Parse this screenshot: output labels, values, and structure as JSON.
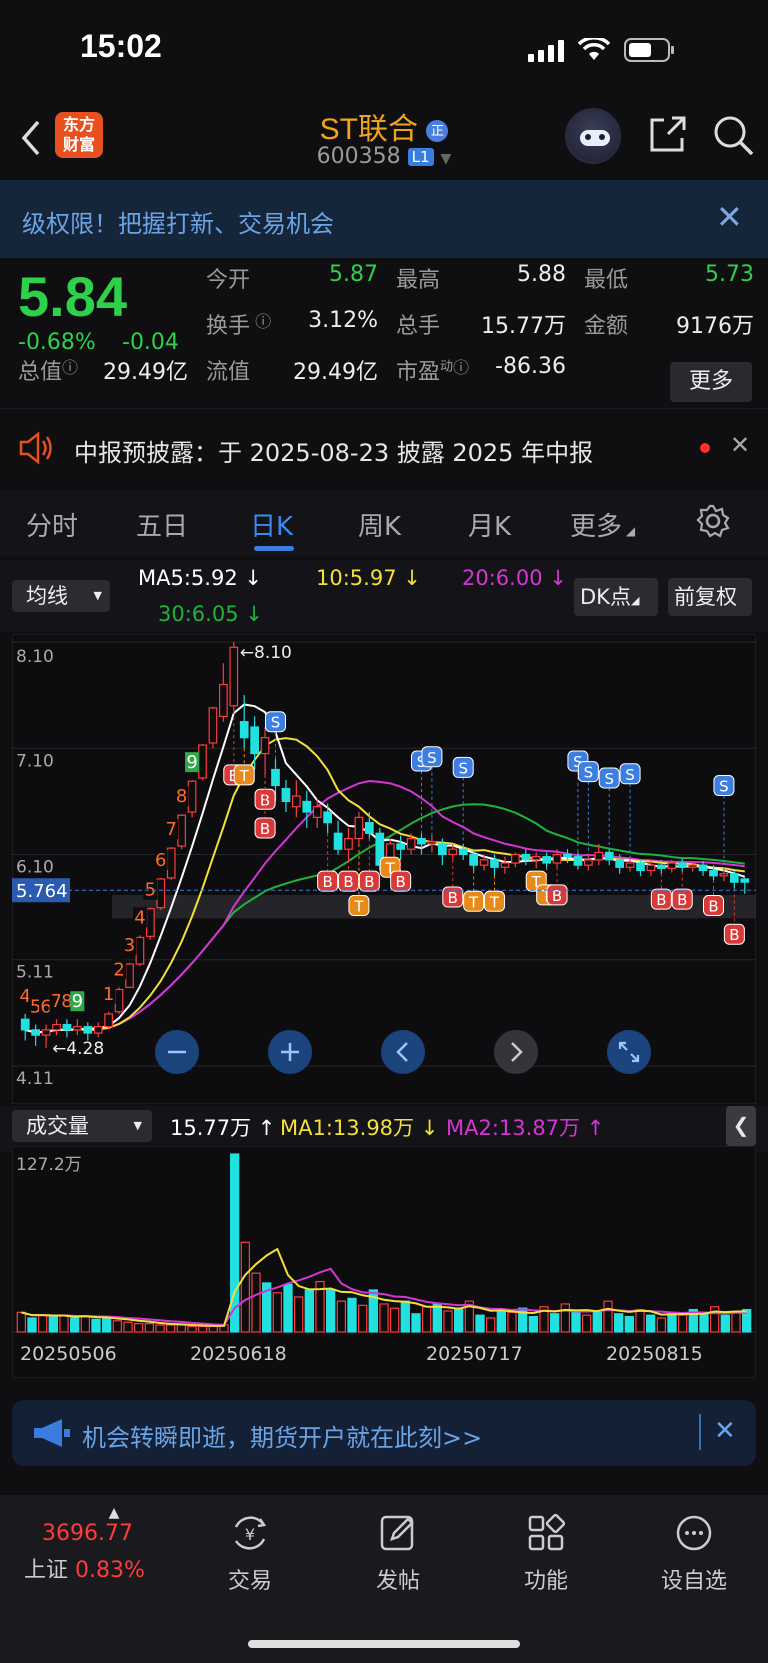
{
  "status_bar": {
    "time": "15:02"
  },
  "header": {
    "logo_text_1": "东方",
    "logo_text_2": "财富",
    "title": "ST联合",
    "title_badge": "正",
    "code": "600358",
    "level_badge": "L1"
  },
  "banner": {
    "text": "级权限！把握打新、交易机会"
  },
  "quote": {
    "price": "5.84",
    "change_pct": "-0.68%",
    "change": "-0.04",
    "fields": [
      {
        "label": "今开",
        "value": "5.87",
        "color": "green"
      },
      {
        "label": "最高",
        "value": "5.88",
        "color": "white"
      },
      {
        "label": "最低",
        "value": "5.73",
        "color": "green"
      },
      {
        "label": "换手",
        "value": "3.12%",
        "color": "white"
      },
      {
        "label": "总手",
        "value": "15.77万",
        "color": "white"
      },
      {
        "label": "金额",
        "value": "9176万",
        "color": "white"
      },
      {
        "label": "总值",
        "value": "29.49亿",
        "color": "white"
      },
      {
        "label": "流值",
        "value": "29.49亿",
        "color": "white"
      },
      {
        "label": "市盈",
        "label_sup": "动",
        "value": "-86.36",
        "color": "white"
      }
    ],
    "more_button": "更多"
  },
  "notice": {
    "text": "中报预披露：于 2025-08-23 披露 2025 年中报"
  },
  "tabs": [
    "分时",
    "五日",
    "日K",
    "周K",
    "月K",
    "更多"
  ],
  "active_tab": "日K",
  "ma_row": {
    "selector": "均线",
    "ma5": "MA5:5.92 ↓",
    "ma10": "10:5.97 ↓",
    "ma20": "20:6.00 ↓",
    "ma30": "30:6.05 ↓",
    "dk_button": "DK点",
    "fq_button": "前复权"
  },
  "colors": {
    "up": "#ff3b3b",
    "down": "#21e0e0",
    "green": "#2fd04a",
    "ma5": "#ffffff",
    "ma10": "#f2e03b",
    "ma20": "#d535d5",
    "ma30": "#1fb33a",
    "accent": "#3a7de0"
  },
  "chart_data": {
    "type": "candlestick",
    "y_labels": [
      "8.10",
      "7.10",
      "6.10",
      "5.11",
      "4.11"
    ],
    "price_line_label": "5.764",
    "high_label": "←8.10",
    "low_label": "←4.28",
    "candles": [
      {
        "o": 4.55,
        "c": 4.45,
        "h": 4.6,
        "l": 4.35
      },
      {
        "o": 4.45,
        "c": 4.4,
        "h": 4.5,
        "l": 4.3
      },
      {
        "o": 4.4,
        "c": 4.45,
        "h": 4.5,
        "l": 4.28
      },
      {
        "o": 4.45,
        "c": 4.5,
        "h": 4.55,
        "l": 4.4
      },
      {
        "o": 4.5,
        "c": 4.45,
        "h": 4.55,
        "l": 4.38
      },
      {
        "o": 4.45,
        "c": 4.48,
        "h": 4.55,
        "l": 4.4
      },
      {
        "o": 4.48,
        "c": 4.42,
        "h": 4.52,
        "l": 4.35
      },
      {
        "o": 4.42,
        "c": 4.48,
        "h": 4.52,
        "l": 4.38
      },
      {
        "o": 4.48,
        "c": 4.6,
        "h": 4.62,
        "l": 4.45
      },
      {
        "o": 4.62,
        "c": 4.83,
        "h": 4.85,
        "l": 4.6
      },
      {
        "o": 4.85,
        "c": 5.07,
        "h": 5.08,
        "l": 4.85
      },
      {
        "o": 5.07,
        "c": 5.32,
        "h": 5.34,
        "l": 5.05
      },
      {
        "o": 5.33,
        "c": 5.59,
        "h": 5.6,
        "l": 5.3
      },
      {
        "o": 5.6,
        "c": 5.87,
        "h": 5.88,
        "l": 5.58
      },
      {
        "o": 5.88,
        "c": 6.16,
        "h": 6.17,
        "l": 5.86
      },
      {
        "o": 6.18,
        "c": 6.47,
        "h": 6.48,
        "l": 6.15
      },
      {
        "o": 6.5,
        "c": 6.79,
        "h": 6.8,
        "l": 6.45
      },
      {
        "o": 6.82,
        "c": 7.13,
        "h": 7.14,
        "l": 6.8
      },
      {
        "o": 7.15,
        "c": 7.48,
        "h": 7.49,
        "l": 7.1
      },
      {
        "o": 7.4,
        "c": 7.7,
        "h": 7.9,
        "l": 7.35
      },
      {
        "o": 7.5,
        "c": 8.05,
        "h": 8.1,
        "l": 7.45
      },
      {
        "o": 7.35,
        "c": 7.2,
        "h": 7.6,
        "l": 7.1
      },
      {
        "o": 7.3,
        "c": 7.05,
        "h": 7.4,
        "l": 6.9
      },
      {
        "o": 7.05,
        "c": 7.2,
        "h": 7.3,
        "l": 6.85
      },
      {
        "o": 6.9,
        "c": 6.75,
        "h": 7.0,
        "l": 6.6
      },
      {
        "o": 6.72,
        "c": 6.6,
        "h": 6.8,
        "l": 6.5
      },
      {
        "o": 6.55,
        "c": 6.65,
        "h": 6.8,
        "l": 6.45
      },
      {
        "o": 6.6,
        "c": 6.5,
        "h": 6.7,
        "l": 6.35
      },
      {
        "o": 6.45,
        "c": 6.55,
        "h": 6.62,
        "l": 6.35
      },
      {
        "o": 6.5,
        "c": 6.4,
        "h": 6.58,
        "l": 6.3
      },
      {
        "o": 6.3,
        "c": 6.15,
        "h": 6.42,
        "l": 6.1
      },
      {
        "o": 6.15,
        "c": 6.25,
        "h": 6.35,
        "l": 6.05
      },
      {
        "o": 6.25,
        "c": 6.45,
        "h": 6.5,
        "l": 6.2
      },
      {
        "o": 6.4,
        "c": 6.3,
        "h": 6.5,
        "l": 6.25
      },
      {
        "o": 6.3,
        "c": 6.0,
        "h": 6.35,
        "l": 5.95
      },
      {
        "o": 6.05,
        "c": 6.2,
        "h": 6.25,
        "l": 5.95
      },
      {
        "o": 6.2,
        "c": 6.15,
        "h": 6.28,
        "l": 6.05
      },
      {
        "o": 6.15,
        "c": 6.25,
        "h": 6.3,
        "l": 6.1
      },
      {
        "o": 6.25,
        "c": 6.2,
        "h": 6.3,
        "l": 6.1
      },
      {
        "o": 6.2,
        "c": 6.22,
        "h": 6.28,
        "l": 6.12
      },
      {
        "o": 6.2,
        "c": 6.1,
        "h": 6.25,
        "l": 6.0
      },
      {
        "o": 6.1,
        "c": 6.15,
        "h": 6.2,
        "l": 6.05
      },
      {
        "o": 6.15,
        "c": 6.1,
        "h": 6.2,
        "l": 6.05
      },
      {
        "o": 6.1,
        "c": 6.0,
        "h": 6.15,
        "l": 5.95
      },
      {
        "o": 6.0,
        "c": 6.05,
        "h": 6.1,
        "l": 5.95
      },
      {
        "o": 6.05,
        "c": 5.98,
        "h": 6.1,
        "l": 5.9
      },
      {
        "o": 5.98,
        "c": 6.02,
        "h": 6.08,
        "l": 5.92
      },
      {
        "o": 6.02,
        "c": 6.1,
        "h": 6.12,
        "l": 5.98
      },
      {
        "o": 6.1,
        "c": 6.05,
        "h": 6.15,
        "l": 6.0
      },
      {
        "o": 6.05,
        "c": 6.08,
        "h": 6.12,
        "l": 6.0
      },
      {
        "o": 6.08,
        "c": 6.02,
        "h": 6.12,
        "l": 5.98
      },
      {
        "o": 6.02,
        "c": 6.1,
        "h": 6.15,
        "l": 5.98
      },
      {
        "o": 6.1,
        "c": 6.08,
        "h": 6.15,
        "l": 6.02
      },
      {
        "o": 6.08,
        "c": 6.0,
        "h": 6.12,
        "l": 5.96
      },
      {
        "o": 6.0,
        "c": 6.05,
        "h": 6.1,
        "l": 5.95
      },
      {
        "o": 6.05,
        "c": 6.12,
        "h": 6.2,
        "l": 6.0
      },
      {
        "o": 6.12,
        "c": 6.05,
        "h": 6.15,
        "l": 6.0
      },
      {
        "o": 6.05,
        "c": 5.98,
        "h": 6.1,
        "l": 5.92
      },
      {
        "o": 5.98,
        "c": 6.02,
        "h": 6.06,
        "l": 5.94
      },
      {
        "o": 6.02,
        "c": 5.95,
        "h": 6.05,
        "l": 5.9
      },
      {
        "o": 5.95,
        "c": 6.0,
        "h": 6.05,
        "l": 5.9
      },
      {
        "o": 6.0,
        "c": 5.97,
        "h": 6.05,
        "l": 5.92
      },
      {
        "o": 5.97,
        "c": 6.02,
        "h": 6.05,
        "l": 5.93
      },
      {
        "o": 6.02,
        "c": 5.98,
        "h": 6.06,
        "l": 5.94
      },
      {
        "o": 5.98,
        "c": 6.0,
        "h": 6.04,
        "l": 5.94
      },
      {
        "o": 6.0,
        "c": 5.95,
        "h": 6.04,
        "l": 5.9
      },
      {
        "o": 5.95,
        "c": 5.9,
        "h": 6.0,
        "l": 5.86
      },
      {
        "o": 5.9,
        "c": 5.92,
        "h": 5.96,
        "l": 5.85
      },
      {
        "o": 5.92,
        "c": 5.84,
        "h": 5.95,
        "l": 5.78
      },
      {
        "o": 5.87,
        "c": 5.84,
        "h": 5.88,
        "l": 5.73
      }
    ],
    "signals": [
      {
        "i": 20,
        "t": "B",
        "price": 6.85
      },
      {
        "i": 21,
        "t": "T",
        "price": 6.85
      },
      {
        "i": 23,
        "t": "B",
        "price": 6.62
      },
      {
        "i": 24,
        "t": "S",
        "price": 7.35
      },
      {
        "i": 23,
        "t": "B",
        "price": 6.35
      },
      {
        "i": 29,
        "t": "B",
        "price": 5.85
      },
      {
        "i": 31,
        "t": "B",
        "price": 5.85
      },
      {
        "i": 32,
        "t": "T",
        "price": 5.62
      },
      {
        "i": 33,
        "t": "B",
        "price": 5.85
      },
      {
        "i": 35,
        "t": "T",
        "price": 5.98
      },
      {
        "i": 36,
        "t": "B",
        "price": 5.85
      },
      {
        "i": 38,
        "t": "S",
        "price": 6.98
      },
      {
        "i": 39,
        "t": "S",
        "price": 7.02
      },
      {
        "i": 42,
        "t": "S",
        "price": 6.92
      },
      {
        "i": 41,
        "t": "B",
        "price": 5.7
      },
      {
        "i": 43,
        "t": "T",
        "price": 5.66
      },
      {
        "i": 45,
        "t": "T",
        "price": 5.66
      },
      {
        "i": 49,
        "t": "T",
        "price": 5.85
      },
      {
        "i": 50,
        "t": "T",
        "price": 5.72
      },
      {
        "i": 51,
        "t": "B",
        "price": 5.72
      },
      {
        "i": 53,
        "t": "S",
        "price": 6.98
      },
      {
        "i": 54,
        "t": "S",
        "price": 6.88
      },
      {
        "i": 56,
        "t": "S",
        "price": 6.82
      },
      {
        "i": 58,
        "t": "S",
        "price": 6.86
      },
      {
        "i": 61,
        "t": "B",
        "price": 5.68
      },
      {
        "i": 63,
        "t": "B",
        "price": 5.68
      },
      {
        "i": 66,
        "t": "B",
        "price": 5.62
      },
      {
        "i": 67,
        "t": "S",
        "price": 6.75
      },
      {
        "i": 68,
        "t": "B",
        "price": 5.35
      }
    ],
    "nine_counts": [
      {
        "i": 0,
        "n": "4",
        "c": "red"
      },
      {
        "i": 1,
        "n": "5",
        "c": "red"
      },
      {
        "i": 2,
        "n": "6",
        "c": "red"
      },
      {
        "i": 3,
        "n": "7",
        "c": "red"
      },
      {
        "i": 4,
        "n": "8",
        "c": "red"
      },
      {
        "i": 5,
        "n": "9",
        "c": "green"
      },
      {
        "i": 8,
        "n": "1",
        "c": "red"
      },
      {
        "i": 9,
        "n": "2",
        "c": "red"
      },
      {
        "i": 10,
        "n": "3",
        "c": "red"
      },
      {
        "i": 11,
        "n": "4",
        "c": "red"
      },
      {
        "i": 12,
        "n": "5",
        "c": "red"
      },
      {
        "i": 13,
        "n": "6",
        "c": "red"
      },
      {
        "i": 14,
        "n": "7",
        "c": "red"
      },
      {
        "i": 15,
        "n": "8",
        "c": "red"
      },
      {
        "i": 16,
        "n": "9",
        "c": "green"
      }
    ]
  },
  "volume": {
    "selector": "成交量",
    "value": "15.77万 ↑",
    "ma1": "MA1:13.98万 ↓",
    "ma2": "MA2:13.87万 ↑",
    "max_label": "127.2万",
    "dates": [
      "20250506",
      "20250618",
      "20250717",
      "20250815"
    ],
    "bars": [
      14,
      10,
      12,
      11,
      12,
      10,
      11,
      9,
      10,
      8,
      7,
      6,
      6,
      5,
      5,
      5,
      4,
      4,
      4,
      5,
      127,
      64,
      42,
      35,
      28,
      34,
      25,
      30,
      36,
      30,
      22,
      24,
      19,
      30,
      20,
      17,
      22,
      13,
      18,
      20,
      15,
      17,
      22,
      12,
      10,
      16,
      14,
      17,
      11,
      18,
      13,
      20,
      15,
      12,
      14,
      22,
      13,
      11,
      16,
      12,
      10,
      14,
      12,
      16,
      13,
      18,
      12,
      14,
      16
    ],
    "bar_up": [
      true,
      false,
      true,
      false,
      true,
      false,
      true,
      false,
      false,
      true,
      true,
      true,
      true,
      true,
      true,
      true,
      true,
      true,
      true,
      true,
      false,
      true,
      true,
      false,
      true,
      false,
      true,
      false,
      true,
      false,
      true,
      false,
      true,
      false,
      true,
      true,
      false,
      false,
      true,
      false,
      true,
      false,
      true,
      false,
      true,
      false,
      true,
      false,
      false,
      true,
      false,
      true,
      false,
      true,
      false,
      true,
      false,
      false,
      true,
      false,
      true,
      false,
      true,
      false,
      false,
      true,
      false,
      true,
      false
    ]
  },
  "promo": {
    "text": "机会转瞬即逝，期货开户就在此刻>>"
  },
  "bottom_nav": {
    "index_value": "3696.77",
    "index_name": "上证",
    "index_pct": "0.83%",
    "items": [
      "交易",
      "发帖",
      "功能",
      "设自选"
    ]
  }
}
